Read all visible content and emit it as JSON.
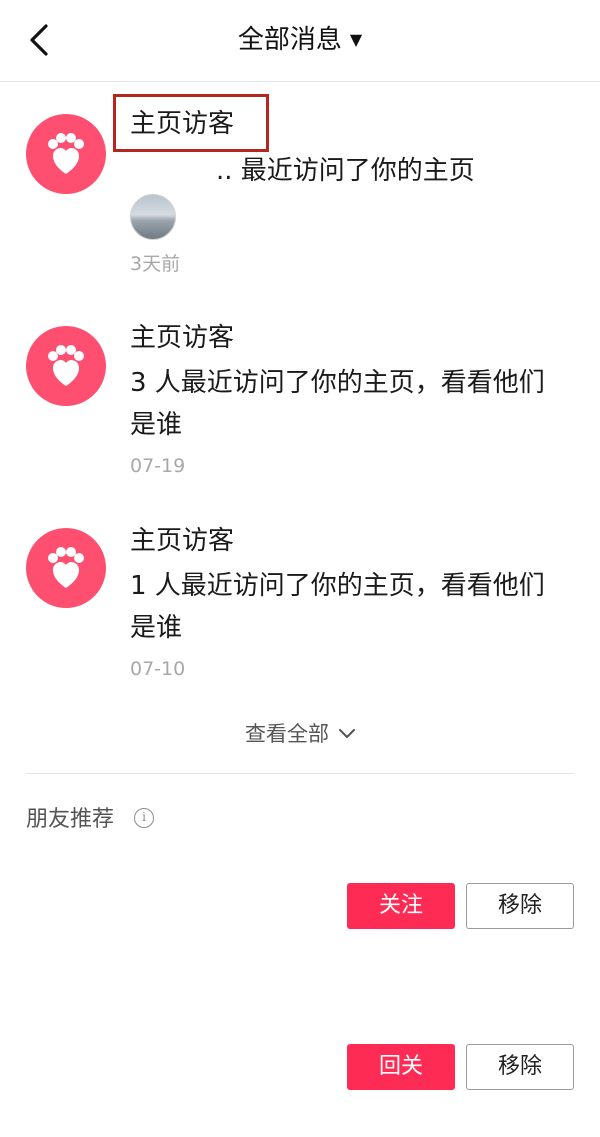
{
  "header": {
    "title": "全部消息",
    "back_icon": "chevron-left-icon",
    "dropdown_icon": "caret-down-icon"
  },
  "notifications": [
    {
      "icon": "paw-heart-icon",
      "title": "主页访客",
      "text": ".. 最近访问了你的主页",
      "time": "3天前",
      "highlighted": true
    },
    {
      "icon": "paw-heart-icon",
      "title": "主页访客",
      "text": "3 人最近访问了你的主页，看看他们是谁",
      "time": "07-19"
    },
    {
      "icon": "paw-heart-icon",
      "title": "主页访客",
      "text": "1 人最近访问了你的主页，看看他们是谁",
      "time": "07-10"
    }
  ],
  "see_all": {
    "label": "查看全部"
  },
  "recommend": {
    "title": "朋友推荐",
    "info_icon": "info-icon",
    "items": [
      {
        "primary_label": "关注",
        "remove_label": "移除"
      },
      {
        "primary_label": "回关",
        "remove_label": "移除"
      }
    ]
  },
  "colors": {
    "accent": "#fe2c55",
    "paw_circle": "#fe4f70",
    "highlight_border": "#b5261e",
    "muted_text": "#a8a8a8"
  }
}
